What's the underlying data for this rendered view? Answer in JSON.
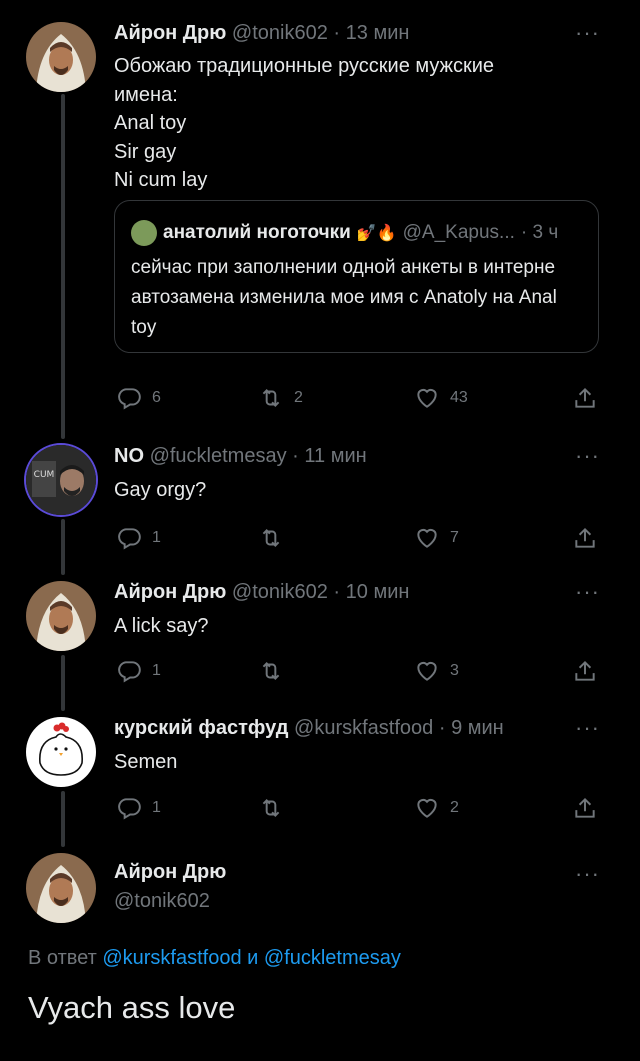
{
  "thread": [
    {
      "name": "Айрон Дрю",
      "handle": "@tonik602",
      "dot": "·",
      "time": "13 мин",
      "text": "Обожаю традиционные русские мужские\nимена:\nAnal toy\nSir gay\nNi cum lay",
      "quote": {
        "name": "анатолий ноготочки",
        "emoji": "💅🔥",
        "handle": "@A_Kapus...",
        "time": "· 3 ч",
        "text": "сейчас при заполнении одной анкеты в интерне автозамена изменила мое имя с Anatoly на Anal toy"
      },
      "replies": "6",
      "retweets": "2",
      "likes": "43"
    },
    {
      "name": "NO",
      "handle": "@fuckletmesay",
      "dot": "·",
      "time": "11 мин",
      "text": "Gay orgy?",
      "replies": "1",
      "retweets": "",
      "likes": "7"
    },
    {
      "name": "Айрон Дрю",
      "handle": "@tonik602",
      "dot": "·",
      "time": "10 мин",
      "text": "A lick say?",
      "replies": "1",
      "retweets": "",
      "likes": "3"
    },
    {
      "name": "курский фастфуд",
      "handle": "@kurskfastfood",
      "dot": "·",
      "time": "9 мин",
      "text": "Semen",
      "replies": "1",
      "retweets": "",
      "likes": "2"
    }
  ],
  "main": {
    "name": "Айрон Дрю",
    "handle": "@tonik602",
    "reply_prefix": "В ответ",
    "mention1": "@kurskfastfood",
    "conj": "и",
    "mention2": "@fuckletmesay",
    "text": "Vyach ass love"
  },
  "more_icon": "···",
  "colors": {
    "background": "#000000",
    "text": "#e7e9ea",
    "muted": "#71767b",
    "link": "#1d9bf0",
    "line": "#333639"
  },
  "icons": [
    "reply-icon",
    "retweet-icon",
    "like-icon",
    "share-icon",
    "more-icon"
  ]
}
